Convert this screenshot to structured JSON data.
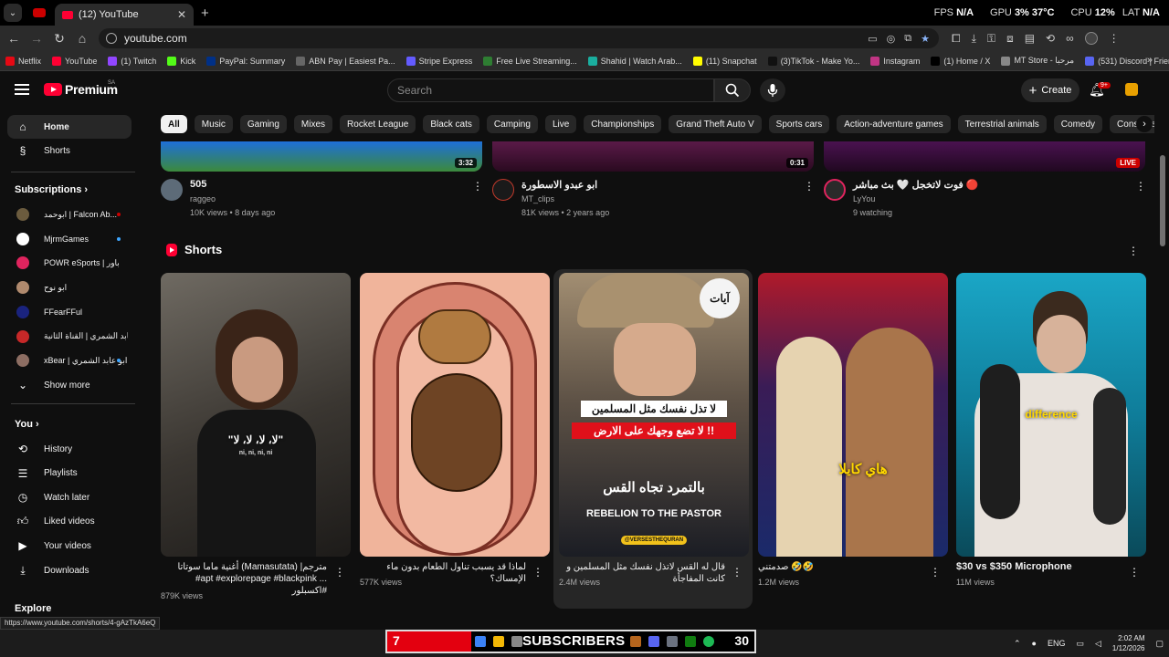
{
  "browser": {
    "tab_title": "(12) YouTube",
    "url": "youtube.com",
    "stats": {
      "fps_label": "FPS",
      "fps": "N/A",
      "gpu_label": "GPU",
      "gpu": "3%",
      "gpu_temp": "37°C",
      "cpu_label": "CPU",
      "cpu": "12%",
      "lat_label": "LAT",
      "lat": "N/A"
    },
    "bookmarks": [
      {
        "label": "Netflix",
        "color": "#e50914"
      },
      {
        "label": "YouTube",
        "color": "#ff0033"
      },
      {
        "label": "(1) Twitch",
        "color": "#9146ff"
      },
      {
        "label": "Kick",
        "color": "#53fc18"
      },
      {
        "label": "PayPal: Summary",
        "color": "#003087"
      },
      {
        "label": "ABN Pay | Easiest Pa...",
        "color": "#666666"
      },
      {
        "label": "Stripe Express",
        "color": "#635bff"
      },
      {
        "label": "Free Live Streaming...",
        "color": "#2e7d32"
      },
      {
        "label": "Shahid | Watch Arab...",
        "color": "#1aae9f"
      },
      {
        "label": "(11) Snapchat",
        "color": "#fffc00"
      },
      {
        "label": "(3)TikTok - Make Yo...",
        "color": "#111111"
      },
      {
        "label": "Instagram",
        "color": "#c13584"
      },
      {
        "label": "(1) Home / X",
        "color": "#000000"
      },
      {
        "label": "MT Store - مرحبا",
        "color": "#888888"
      },
      {
        "label": "(531) Discord | Frien...",
        "color": "#5865f2"
      }
    ]
  },
  "header": {
    "logo_text": "Premium",
    "country_code": "SA",
    "search_placeholder": "Search",
    "create_label": "Create",
    "notif_count": "9+"
  },
  "sidebar": {
    "main": [
      {
        "label": "Home",
        "icon": "home-icon"
      },
      {
        "label": "Shorts",
        "icon": "shorts-icon"
      }
    ],
    "subs_heading": "Subscriptions",
    "subscriptions": [
      {
        "label": "ابوحمد | Falcon Ab...",
        "color": "#6b5b3e",
        "dot": "#cc0000"
      },
      {
        "label": "MjrmGames",
        "color": "#ffffff",
        "dot": "#3ea6ff"
      },
      {
        "label": "POWR eSports | باور",
        "color": "#e0245e",
        "dot": ""
      },
      {
        "label": "ابو نوح",
        "color": "#b08a6e",
        "dot": ""
      },
      {
        "label": "FFearFFul",
        "color": "#1a237e",
        "dot": ""
      },
      {
        "label": "ابو عابد الشمري | القناة الثانية",
        "color": "#c62828",
        "dot": ""
      },
      {
        "label": "xBear | ابو عابد الشمري ...",
        "color": "#8d6e63",
        "dot": "#3ea6ff"
      }
    ],
    "show_more": "Show more",
    "you_heading": "You",
    "you_items": [
      {
        "label": "History",
        "icon": "history-icon"
      },
      {
        "label": "Playlists",
        "icon": "playlists-icon"
      },
      {
        "label": "Watch later",
        "icon": "watch-later-icon"
      },
      {
        "label": "Liked videos",
        "icon": "like-icon"
      },
      {
        "label": "Your videos",
        "icon": "your-videos-icon"
      },
      {
        "label": "Downloads",
        "icon": "download-icon"
      }
    ],
    "explore_heading": "Explore"
  },
  "chips": [
    "All",
    "Music",
    "Gaming",
    "Mixes",
    "Rocket League",
    "Black cats",
    "Camping",
    "Live",
    "Championships",
    "Grand Theft Auto V",
    "Sports cars",
    "Action-adventure games",
    "Terrestrial animals",
    "Comedy",
    "Consumer Elec"
  ],
  "videos": [
    {
      "title": "505",
      "channel": "raggeo",
      "stats": "10K views • 8 days ago",
      "badge": "3:32",
      "live": false,
      "color": "#2c6fd0"
    },
    {
      "title": "ابو عبدو الاسطورة",
      "channel": "MT_clips",
      "stats": "81K views • 2 years ago",
      "badge": "0:31",
      "live": false,
      "color": "#4a1a3e"
    },
    {
      "title": "فوت لاتخجل 🤍 بث مباشر 🔴",
      "channel": "LyYou",
      "stats": "9 watching",
      "badge": "LIVE",
      "live": true,
      "color": "#3a1040"
    }
  ],
  "shorts_heading": "Shorts",
  "shorts": [
    {
      "title": "أغنية ماما سوتاتا (Mamasutata) |مترجم #apt #explorepage #blackpink ... اكسبلور#",
      "views": "879K views",
      "overlay": "\"لا، لا، لا، لا\"",
      "overlay_sub": "ni, ni, ni, ni"
    },
    {
      "title": "لماذا قد يسبب تناول الطعام بدون ماء الإمساك؟",
      "views": "577K views",
      "overlay": "",
      "overlay_sub": ""
    },
    {
      "title": "قال له القس لاتذل نفسك مثل المسلمين و كانت المفاجأة",
      "views": "2.4M views",
      "overlay": "لا تذل نفسك مثل المسلمين",
      "overlay_sub": "لا تضع وجهك على الارض !!"
    },
    {
      "title": "صدمتني 🤣🤣",
      "views": "1.2M views",
      "overlay": "هاي كايلا",
      "overlay_sub": ""
    },
    {
      "title": "$30 vs $350 Microphone",
      "views": "11M views",
      "overlay": "difference",
      "overlay_sub": ""
    }
  ],
  "short3_extra": {
    "line3": "بالتمرد تجاه القس",
    "line4": "REBELION TO THE PASTOR",
    "tag": "@VERSESTHEQURAN",
    "logo": "آيات"
  },
  "status_url": "https://www.youtube.com/shorts/4-gAzTkA6eQ",
  "taskbar": {
    "left_num": "7",
    "label": "SUBSCRIBERS",
    "right_num": "30",
    "lang": "ENG",
    "time": "2:02 AM",
    "date": "1/12/2026"
  }
}
